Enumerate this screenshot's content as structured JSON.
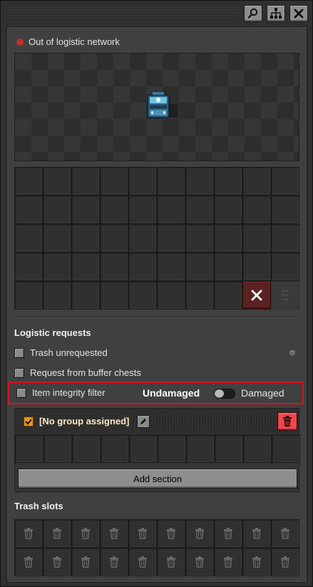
{
  "titlebar": {
    "buttons": [
      {
        "name": "search-icon"
      },
      {
        "name": "logistic-network-icon"
      },
      {
        "name": "close-icon"
      }
    ]
  },
  "status": {
    "text": "Out of logistic network",
    "color": "#d32a23"
  },
  "inventory": {
    "rows": 5,
    "cols": 10
  },
  "logistic_requests": {
    "heading": "Logistic requests",
    "trash_unrequested": {
      "label": "Trash unrequested",
      "checked": false
    },
    "request_from_buffer": {
      "label": "Request from buffer chests",
      "checked": false
    },
    "item_integrity": {
      "label": "Item integrity filter",
      "checked": false,
      "option_left": "Undamaged",
      "option_right": "Damaged",
      "selected": "Undamaged"
    }
  },
  "section": {
    "enabled": true,
    "title": "[No group assigned]",
    "slot_count": 10,
    "add_section_label": "Add section"
  },
  "trash": {
    "heading": "Trash slots",
    "rows": 2,
    "cols": 10
  },
  "colors": {
    "accent_orange": "#e49423",
    "danger_red": "#f0464a",
    "highlight_border": "#d0161d"
  }
}
